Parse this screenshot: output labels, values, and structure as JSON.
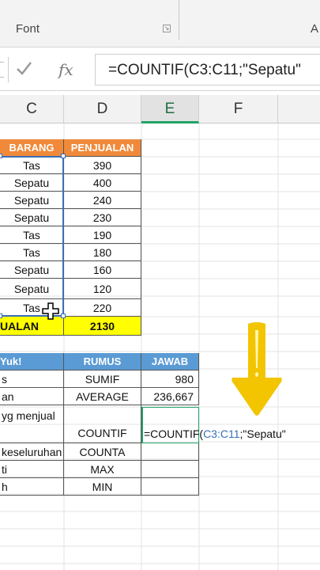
{
  "ribbon": {
    "font_group_label": "Font",
    "right_label": "A"
  },
  "formula_bar": {
    "cancel_icon": "check-icon",
    "fx_label": "fx",
    "content": "=COUNTIF(C3:C11;\"Sepatu\""
  },
  "columns": [
    "C",
    "D",
    "E",
    "F"
  ],
  "selected_column": "E",
  "table1": {
    "headers": {
      "barang": "BARANG",
      "penjualan": "PENJUALAN"
    },
    "rows": [
      {
        "barang": "Tas",
        "penjualan": "390"
      },
      {
        "barang": "Sepatu",
        "penjualan": "400"
      },
      {
        "barang": "Sepatu",
        "penjualan": "240"
      },
      {
        "barang": "Sepatu",
        "penjualan": "230"
      },
      {
        "barang": "Tas",
        "penjualan": "190"
      },
      {
        "barang": "Tas",
        "penjualan": "180"
      },
      {
        "barang": "Sepatu",
        "penjualan": "160"
      },
      {
        "barang": "Sepatu",
        "penjualan": "120"
      },
      {
        "barang": "Tas",
        "penjualan": "220"
      }
    ],
    "total_label": "UALAN",
    "total_value": "2130"
  },
  "table2": {
    "headers": {
      "task": "Yuk!",
      "rumus": "RUMUS",
      "jawab": "JAWAB"
    },
    "rows": [
      {
        "task": "s",
        "rumus": "SUMIF",
        "jawab": "980"
      },
      {
        "task": "an",
        "rumus": "AVERAGE",
        "jawab": "236,667"
      },
      {
        "task": "yg menjual",
        "rumus": "COUNTIF",
        "jawab": ""
      },
      {
        "task": "keseluruhan",
        "rumus": "COUNTA",
        "jawab": ""
      },
      {
        "task": "ti",
        "rumus": "MAX",
        "jawab": ""
      },
      {
        "task": "h",
        "rumus": "MIN",
        "jawab": ""
      }
    ]
  },
  "editing": {
    "prefix": "=COUNTIF(",
    "ref": "C3:C11",
    "suffix": ";\"Sepatu\""
  },
  "colors": {
    "orange": "#f08a3a",
    "blue": "#5b9bd5",
    "yellow": "#ffff00",
    "arrow": "#f2c500",
    "range": "#3b6fb6"
  }
}
